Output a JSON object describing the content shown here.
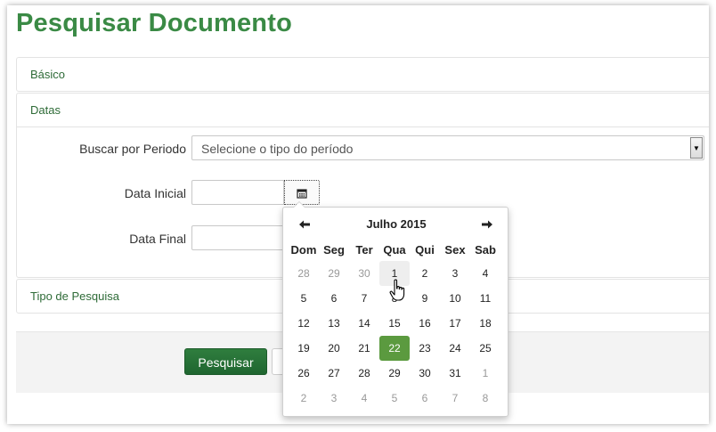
{
  "page": {
    "title": "Pesquisar Documento"
  },
  "sections": {
    "basico": "Básico",
    "datas": "Datas",
    "tipo_pesquisa": "Tipo de Pesquisa"
  },
  "form": {
    "buscar_label": "Buscar por Periodo",
    "buscar_value": "Selecione o tipo do período",
    "data_inicial_label": "Data Inicial",
    "data_inicial_value": "",
    "data_final_label": "Data Final",
    "data_final_value": ""
  },
  "buttons": {
    "pesquisar": "Pesquisar",
    "limpar": "L"
  },
  "icons": {
    "calendar": "calendar-icon",
    "select_arrow": "chevron-down-icon",
    "prev": "arrow-left-icon",
    "next": "arrow-right-icon",
    "pointer": "hand-pointer-icon"
  },
  "datepicker": {
    "month_label": "Julho 2015",
    "prev": "🡐",
    "next": "🡒",
    "weekdays": [
      "Dom",
      "Seg",
      "Ter",
      "Qua",
      "Qui",
      "Sex",
      "Sab"
    ],
    "weeks": [
      [
        "28",
        "29",
        "30",
        "1",
        "2",
        "3",
        "4"
      ],
      [
        "5",
        "6",
        "7",
        "8",
        "9",
        "10",
        "11"
      ],
      [
        "12",
        "13",
        "14",
        "15",
        "16",
        "17",
        "18"
      ],
      [
        "19",
        "20",
        "21",
        "22",
        "23",
        "24",
        "25"
      ],
      [
        "26",
        "27",
        "28",
        "29",
        "30",
        "31",
        "1"
      ],
      [
        "2",
        "3",
        "4",
        "5",
        "6",
        "7",
        "8"
      ]
    ],
    "selected_day": "22",
    "hovered_day": "1",
    "accent_color": "#5b9a3f"
  },
  "colors": {
    "title": "#3a8a45",
    "primary_button": "#1f6630"
  }
}
